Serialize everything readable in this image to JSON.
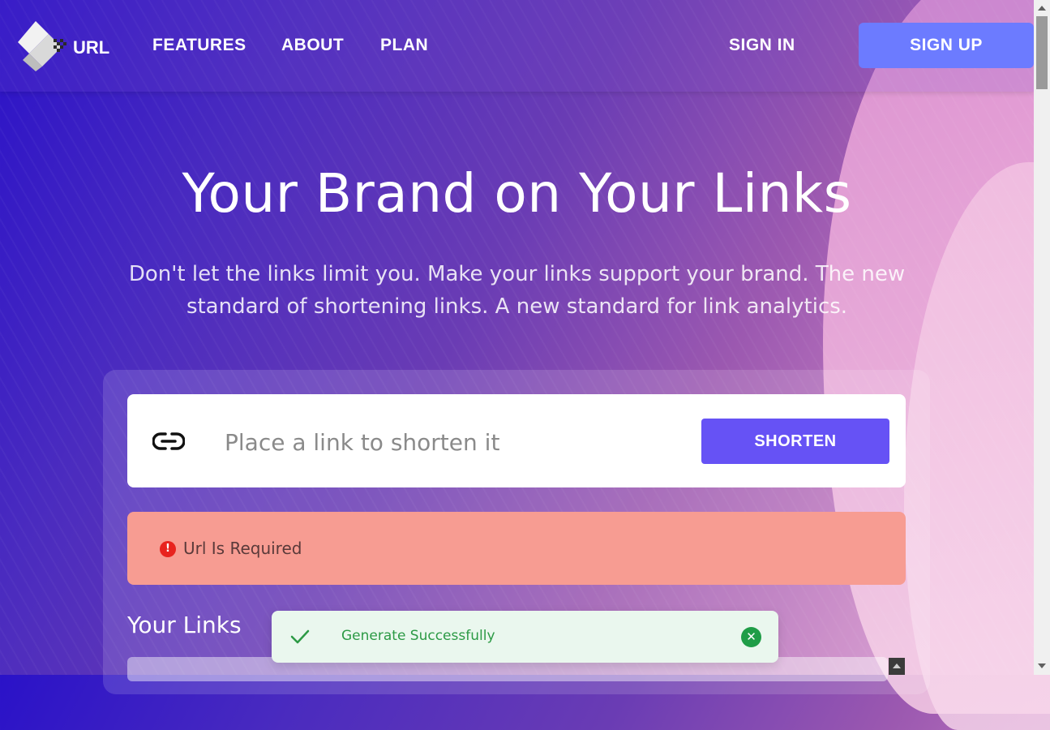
{
  "header": {
    "logo_text": "URL",
    "nav": [
      "FEATURES",
      "ABOUT",
      "PLAN"
    ],
    "sign_in": "SIGN IN",
    "sign_up": "SIGN UP"
  },
  "hero": {
    "title": "Your Brand on Your Links",
    "subtitle": "Don't let the links limit you. Make your links support your brand. The new standard of shortening links. A new standard for link analytics."
  },
  "shortener": {
    "placeholder": "Place a link to shorten it",
    "button": "SHORTEN",
    "error": "Url Is Required"
  },
  "links": {
    "heading": "Your Links"
  },
  "toast": {
    "message": "Generate Successfully"
  },
  "colors": {
    "accent": "#6652f5",
    "signup": "#6c7bff",
    "error_bg": "#f79c92",
    "toast_bg": "#eaf7ee",
    "toast_text": "#2c9a45"
  }
}
